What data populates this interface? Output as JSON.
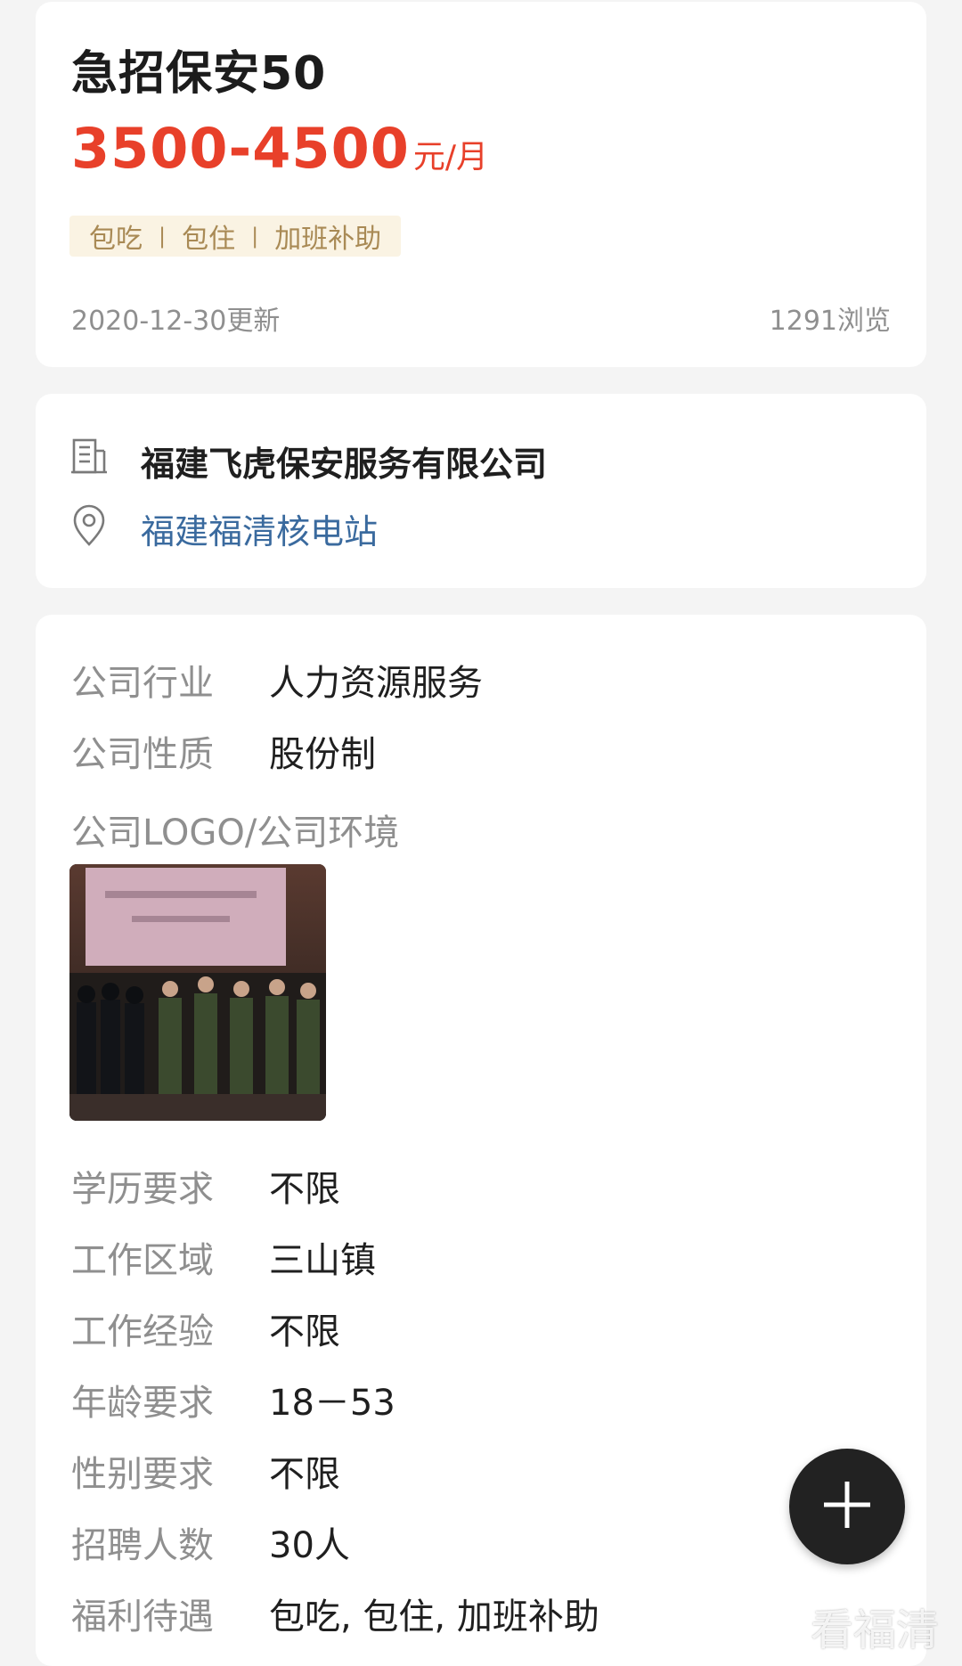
{
  "job": {
    "title": "急招保安50",
    "salary_amount": "3500-4500",
    "salary_unit": "元/月",
    "tags": [
      "包吃",
      "包住",
      "加班补助"
    ],
    "updated": "2020-12-30更新",
    "views": "1291浏览"
  },
  "company": {
    "name": "福建飞虎保安服务有限公司",
    "location": "福建福清核电站"
  },
  "details": {
    "industry": {
      "label": "公司行业",
      "value": "人力资源服务"
    },
    "nature": {
      "label": "公司性质",
      "value": "股份制"
    },
    "logo_label": "公司LOGO/公司环境",
    "education": {
      "label": "学历要求",
      "value": "不限"
    },
    "area": {
      "label": "工作区域",
      "value": "三山镇"
    },
    "experience": {
      "label": "工作经验",
      "value": "不限"
    },
    "age": {
      "label": "年龄要求",
      "value": "18－53"
    },
    "gender": {
      "label": "性别要求",
      "value": "不限"
    },
    "headcount": {
      "label": "招聘人数",
      "value": "30人"
    },
    "benefits": {
      "label": "福利待遇",
      "value": "包吃, 包住, 加班补助"
    }
  },
  "fab_icon": "plus-icon",
  "watermark": "看福清",
  "colors": {
    "salary": "#e8402a",
    "tag_bg": "#faf3e3",
    "tag_text": "#a98a55",
    "location": "#3a6a9e",
    "fab": "#222222"
  }
}
